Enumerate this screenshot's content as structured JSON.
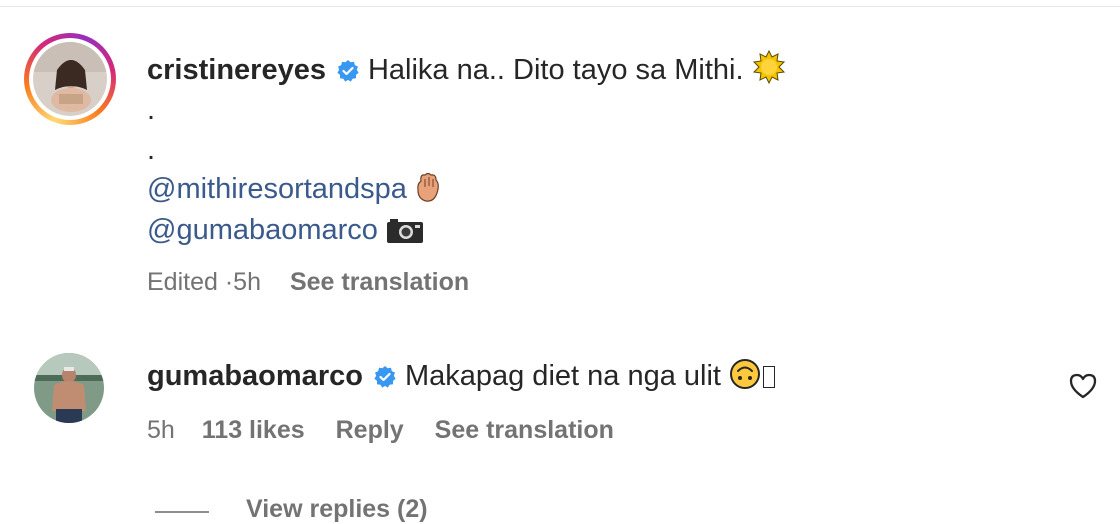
{
  "comments": [
    {
      "username": "cristinereyes",
      "verified": true,
      "text": "Halika na.. Dito tayo sa Mithi.",
      "lines": [
        ".",
        "."
      ],
      "mentions": [
        "@mithiresortandspa",
        "@gumabaomarco"
      ],
      "meta": {
        "edited": "Edited",
        "separator": "·",
        "time": "5h",
        "see_translation": "See translation"
      },
      "emoji_icons": [
        "sun-emoji-icon",
        "hand-emoji-icon",
        "camera-emoji-icon"
      ]
    },
    {
      "username": "gumabaomarco",
      "verified": true,
      "text": "Makapag diet na nga ulit",
      "meta": {
        "time": "5h",
        "likes": "113 likes",
        "reply": "Reply",
        "see_translation": "See translation"
      },
      "emoji_icons": [
        "upside-down-face-emoji-icon"
      ],
      "view_replies": "View replies (2)"
    }
  ],
  "colors": {
    "verified": "#3897f0",
    "mention": "#3a5a8c",
    "meta": "#737373",
    "text": "#262626"
  }
}
